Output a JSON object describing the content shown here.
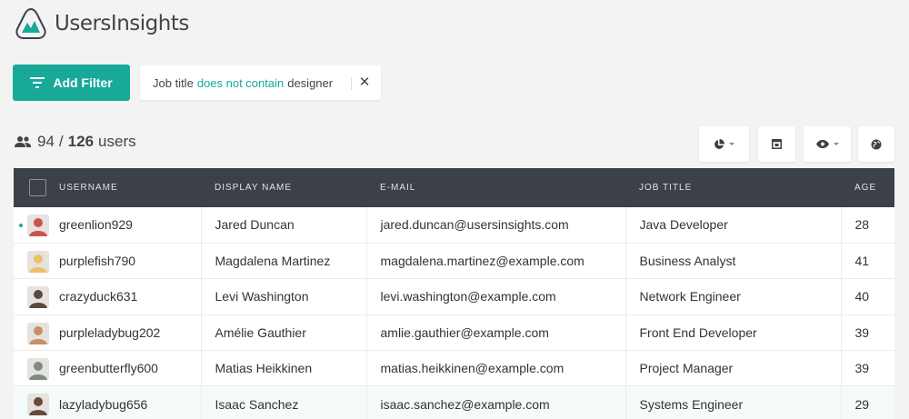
{
  "app": {
    "brand": "UsersInsights"
  },
  "filter_bar": {
    "add_filter_label": "Add Filter",
    "active_filter": {
      "field": "Job title",
      "operator": "does not contain",
      "value": "designer"
    }
  },
  "summary": {
    "filtered": "94",
    "separator": "/",
    "total": "126",
    "unit": "users"
  },
  "toolbar": {
    "icons": [
      "pie-chart-icon",
      "layout-icon",
      "eye-icon",
      "globe-icon"
    ]
  },
  "table": {
    "columns": [
      "USERNAME",
      "DISPLAY NAME",
      "E-MAIL",
      "JOB TITLE",
      "AGE"
    ],
    "rows": [
      {
        "username": "greenlion929",
        "display": "Jared Duncan",
        "email": "jared.duncan@usersinsights.com",
        "job": "Java Developer",
        "age": "28",
        "avatar_color": "#c9554a",
        "online": true
      },
      {
        "username": "purplefish790",
        "display": "Magdalena Martinez",
        "email": "magdalena.martinez@example.com",
        "job": "Business Analyst",
        "age": "41",
        "avatar_color": "#e8c16b",
        "online": false
      },
      {
        "username": "crazyduck631",
        "display": "Levi Washington",
        "email": "levi.washington@example.com",
        "job": "Network Engineer",
        "age": "40",
        "avatar_color": "#5a4a3c",
        "online": false
      },
      {
        "username": "purpleladybug202",
        "display": "Amélie Gauthier",
        "email": "amlie.gauthier@example.com",
        "job": "Front End Developer",
        "age": "39",
        "avatar_color": "#c98f63",
        "online": false
      },
      {
        "username": "greenbutterfly600",
        "display": "Matias Heikkinen",
        "email": "matias.heikkinen@example.com",
        "job": "Project Manager",
        "age": "39",
        "avatar_color": "#7d8b86",
        "online": false
      },
      {
        "username": "lazyladybug656",
        "display": "Isaac Sanchez",
        "email": "isaac.sanchez@example.com",
        "job": "Systems Engineer",
        "age": "29",
        "avatar_color": "#6b4a3a",
        "online": false
      }
    ]
  },
  "colors": {
    "accent": "#18a999",
    "header_bg": "#3b4049",
    "page_bg": "#f3f3f4"
  }
}
